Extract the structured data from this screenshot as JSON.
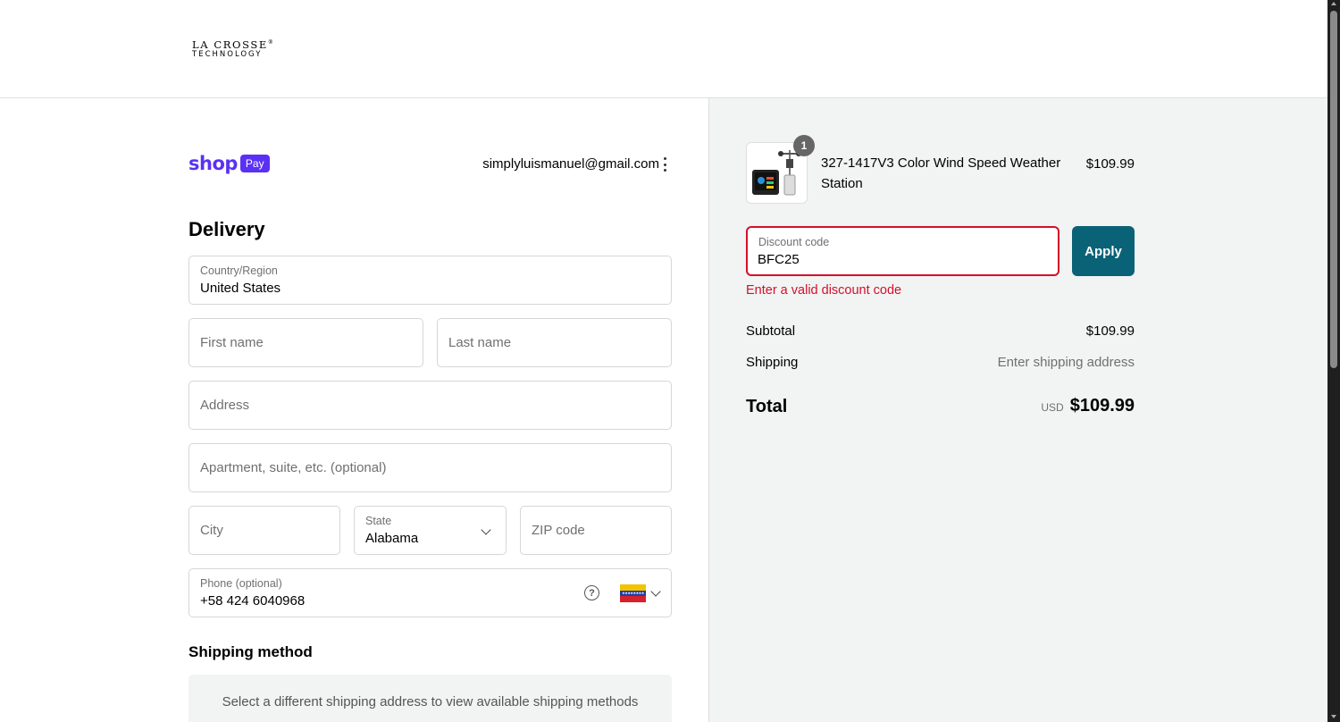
{
  "header": {
    "logo_line1": "LA CROSSE",
    "logo_mark": "®",
    "logo_line2": "TECHNOLOGY"
  },
  "account": {
    "shop_word": "shop",
    "pay_badge": "Pay",
    "email": "simplyluismanuel@gmail.com",
    "menu_icon": "more-vertical-icon"
  },
  "delivery": {
    "heading": "Delivery",
    "country": {
      "label": "Country/Region",
      "value": "United States"
    },
    "first_name": {
      "placeholder": "First name"
    },
    "last_name": {
      "placeholder": "Last name"
    },
    "address": {
      "placeholder": "Address"
    },
    "apartment": {
      "placeholder": "Apartment, suite, etc. (optional)"
    },
    "city": {
      "placeholder": "City"
    },
    "state": {
      "label": "State",
      "value": "Alabama"
    },
    "zip": {
      "placeholder": "ZIP code"
    },
    "phone": {
      "label": "Phone (optional)",
      "value": "+58 424 6040968",
      "help_glyph": "?",
      "flag": "Venezuela"
    }
  },
  "shipping_method": {
    "heading": "Shipping method",
    "message": "Select a different shipping address to view available shipping methods"
  },
  "order": {
    "item": {
      "quantity": "1",
      "name": "327-1417V3 Color Wind Speed Weather Station",
      "price": "$109.99"
    },
    "discount": {
      "label": "Discount code",
      "value": "BFC25",
      "apply_label": "Apply",
      "error": "Enter a valid discount code"
    },
    "subtotal": {
      "label": "Subtotal",
      "value": "$109.99"
    },
    "shipping": {
      "label": "Shipping",
      "value": "Enter shipping address"
    },
    "total": {
      "label": "Total",
      "currency": "USD",
      "value": "$109.99"
    }
  },
  "colors": {
    "shop_purple": "#5a31f4",
    "apply_teal": "#0a6277",
    "error_red": "#d3102a",
    "summary_bg": "#f2f3f3"
  }
}
